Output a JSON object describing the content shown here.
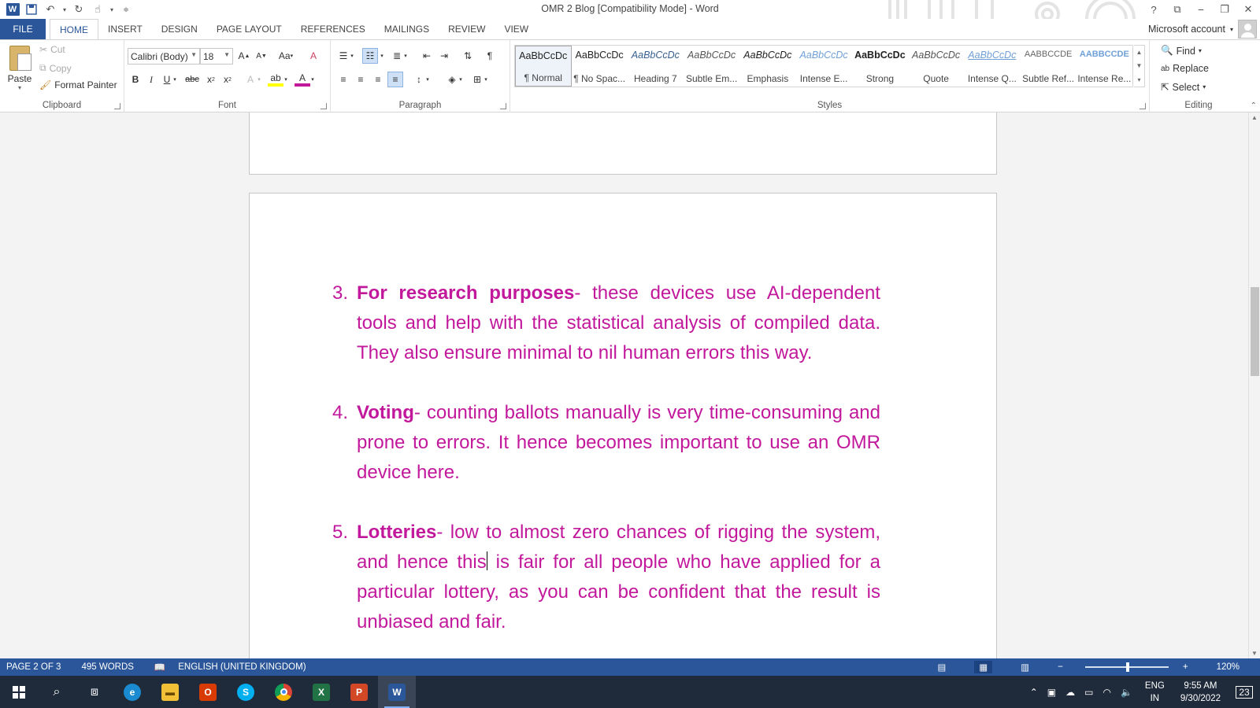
{
  "window": {
    "title": "OMR 2 Blog [Compatibility Mode] - Word",
    "help": "?",
    "controls": [
      "⎯",
      "❐",
      "✕"
    ]
  },
  "tabs": [
    "FILE",
    "HOME",
    "INSERT",
    "DESIGN",
    "PAGE LAYOUT",
    "REFERENCES",
    "MAILINGS",
    "REVIEW",
    "VIEW"
  ],
  "account": {
    "label": "Microsoft account"
  },
  "clipboard": {
    "label": "Clipboard",
    "paste": "Paste",
    "cut": "Cut",
    "copy": "Copy",
    "format_painter": "Format Painter"
  },
  "font": {
    "label": "Font",
    "family": "Calibri (Body)",
    "size": "18",
    "change_case": "Aa"
  },
  "paragraph": {
    "label": "Paragraph"
  },
  "styles": {
    "label": "Styles",
    "items": [
      {
        "preview": "AaBbCcDc",
        "name": "¶ Normal"
      },
      {
        "preview": "AaBbCcDc",
        "name": "¶ No Spac..."
      },
      {
        "preview": "AaBbCcDc",
        "name": "Heading 7"
      },
      {
        "preview": "AaBbCcDc",
        "name": "Subtle Em..."
      },
      {
        "preview": "AaBbCcDc",
        "name": "Emphasis"
      },
      {
        "preview": "AaBbCcDc",
        "name": "Intense E..."
      },
      {
        "preview": "AaBbCcDc",
        "name": "Strong"
      },
      {
        "preview": "AaBbCcDc",
        "name": "Quote"
      },
      {
        "preview": "AaBbCcDc",
        "name": "Intense Q..."
      },
      {
        "preview": "AABBCCDE",
        "name": "Subtle Ref..."
      },
      {
        "preview": "AABBCCDE",
        "name": "Intense Re..."
      }
    ]
  },
  "editing": {
    "label": "Editing",
    "find": "Find",
    "replace": "Replace",
    "select": "Select"
  },
  "document": {
    "text_color": "#c2189c",
    "items": [
      {
        "num": "3.",
        "bold": "For research purposes",
        "text": "- these devices use AI-dependent tools and help with the statistical analysis of compiled data. They also ensure minimal to nil human errors this way."
      },
      {
        "num": "4.",
        "bold": "Voting",
        "text": "- counting ballots manually is very time-consuming and prone to errors. It hence becomes important to use an OMR device here."
      },
      {
        "num": "5.",
        "bold": "Lotteries",
        "text_before_cursor": "- low to almost zero chances of rigging the system, and hence this",
        "text_after_cursor": " is fair for all people who have applied for a particular lottery, as you can be confident that the result is unbiased and fair."
      }
    ]
  },
  "status": {
    "page": "PAGE 2 OF 3",
    "words": "495 WORDS",
    "language": "ENGLISH (UNITED KINGDOM)",
    "zoom": "120%"
  },
  "taskbar": {
    "lang_top": "ENG",
    "lang_bottom": "IN",
    "time": "9:55 AM",
    "date": "9/30/2022",
    "notifications": "23"
  }
}
